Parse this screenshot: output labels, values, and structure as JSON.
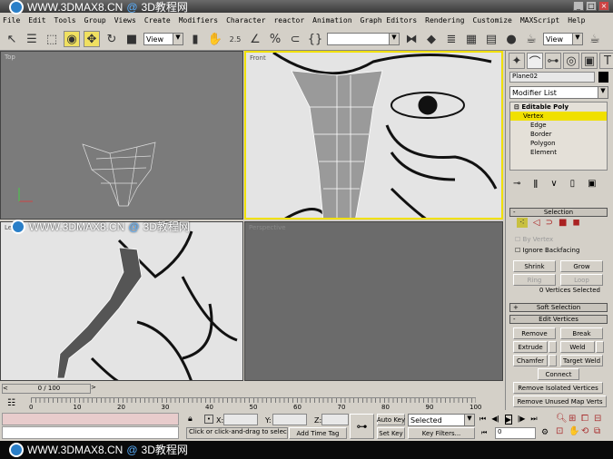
{
  "watermark": {
    "site": "WWW.3DMAX8.CN",
    "at": "@",
    "name": "3D教程网"
  },
  "menu": [
    "File",
    "Edit",
    "Tools",
    "Group",
    "Views",
    "Create",
    "Modifiers",
    "Character",
    "reactor",
    "Animation",
    "Graph Editors",
    "Rendering",
    "Customize",
    "MAXScript",
    "Help"
  ],
  "toolbar": {
    "ref_coord": "View",
    "snap_label": "2.5",
    "percent_snap": "%",
    "named_sel": "",
    "render_view": "View"
  },
  "viewports": {
    "top": "Top",
    "front": "Front",
    "left": "Left",
    "perspective": "Perspective"
  },
  "command_panel": {
    "object_name": "Plane02",
    "object_color": "#000000",
    "modifier_list": "Modifier List",
    "stack": {
      "root": "Editable Poly",
      "items": [
        "Vertex",
        "Edge",
        "Border",
        "Polygon",
        "Element"
      ],
      "selected": "Vertex"
    },
    "selection": {
      "title": "Selection",
      "by_vertex": "By Vertex",
      "ignore_backfacing": "Ignore Backfacing",
      "shrink": "Shrink",
      "grow": "Grow",
      "ring": "Ring",
      "loop": "Loop",
      "status": "0 Vertices Selected"
    },
    "soft_selection": "Soft Selection",
    "edit_vertices": {
      "title": "Edit Vertices",
      "remove": "Remove",
      "break": "Break",
      "extrude": "Extrude",
      "weld": "Weld",
      "chamfer": "Chamfer",
      "target_weld": "Target Weld",
      "connect": "Connect",
      "remove_isolated": "Remove Isolated Vertices",
      "remove_unused": "Remove Unused Map Verts"
    }
  },
  "timeline": {
    "frame": "0 / 100",
    "ticks": [
      "0",
      "10",
      "20",
      "30",
      "40",
      "50",
      "60",
      "70",
      "80",
      "90",
      "100"
    ]
  },
  "status": {
    "x_label": "X:",
    "y_label": "Y:",
    "z_label": "Z:",
    "prompt": "Click or click-and-drag to select ob",
    "add_time_tag": "Add Time Tag",
    "auto_key": "Auto Key",
    "set_key": "Set Key",
    "key_mode": "Selected",
    "key_filters": "Key Filters...",
    "current_frame": "0"
  },
  "colors": {
    "active_viewport": "#f0e000",
    "selected_item": "#f0e000"
  }
}
